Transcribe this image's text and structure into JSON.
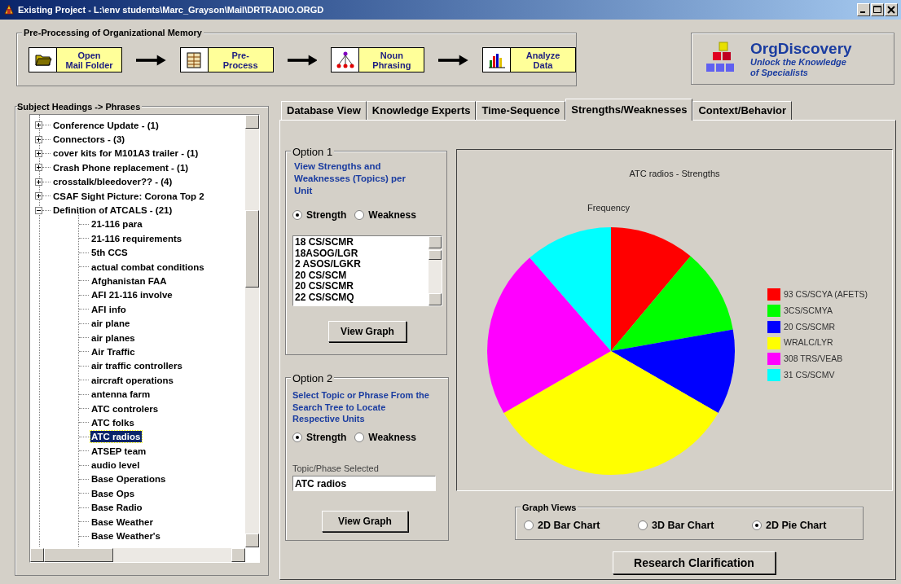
{
  "window": {
    "title": "Existing Project - L:\\env students\\Marc_Grayson\\Mail\\DRTRADIO.ORGD"
  },
  "toolbar": {
    "title": "Pre-Processing of Organizational Memory",
    "steps": [
      {
        "kind": "folder",
        "lines": [
          "Open",
          "Mail Folder"
        ]
      },
      {
        "kind": "table",
        "lines": [
          "Pre-",
          "Process"
        ]
      },
      {
        "kind": "tree",
        "lines": [
          "Noun",
          "Phrasing"
        ]
      },
      {
        "kind": "bars",
        "lines": [
          "Analyze",
          "Data"
        ]
      }
    ]
  },
  "logo": {
    "name": "OrgDiscovery",
    "tagline": [
      "Unlock the Knowledge",
      "of Specialists"
    ]
  },
  "tree": {
    "title": "Subject Headings -> Phrases",
    "items": [
      {
        "label": "Conference Update - (1)",
        "expanded": false,
        "selected": false
      },
      {
        "label": "Connectors - (3)",
        "expanded": false,
        "selected": false
      },
      {
        "label": "cover kits for M101A3 trailer - (1)",
        "expanded": false,
        "selected": false
      },
      {
        "label": "Crash Phone replacement - (1)",
        "expanded": false,
        "selected": false
      },
      {
        "label": "crosstalk/bleedover?? - (4)",
        "expanded": false,
        "selected": false
      },
      {
        "label": "CSAF Sight Picture: Corona Top 2",
        "expanded": false,
        "selected": false
      },
      {
        "label": "Definition of ATCALS - (21)",
        "expanded": true,
        "selected": false,
        "children": [
          {
            "label": "21-116 para",
            "selected": false
          },
          {
            "label": "21-116 requirements",
            "selected": false
          },
          {
            "label": "5th CCS",
            "selected": false
          },
          {
            "label": "actual combat conditions",
            "selected": false
          },
          {
            "label": "Afghanistan FAA",
            "selected": false
          },
          {
            "label": "AFI 21-116 involve",
            "selected": false
          },
          {
            "label": "AFI info",
            "selected": false
          },
          {
            "label": "air plane",
            "selected": false
          },
          {
            "label": "air planes",
            "selected": false
          },
          {
            "label": "Air Traffic",
            "selected": false
          },
          {
            "label": "air traffic controllers",
            "selected": false
          },
          {
            "label": "aircraft operations",
            "selected": false
          },
          {
            "label": "antenna farm",
            "selected": false
          },
          {
            "label": "ATC controlers",
            "selected": false
          },
          {
            "label": "ATC folks",
            "selected": false
          },
          {
            "label": "ATC radios",
            "selected": true
          },
          {
            "label": "ATSEP team",
            "selected": false
          },
          {
            "label": "audio level",
            "selected": false
          },
          {
            "label": "Base Operations",
            "selected": false
          },
          {
            "label": "Base Ops",
            "selected": false
          },
          {
            "label": "Base Radio",
            "selected": false
          },
          {
            "label": "Base Weather",
            "selected": false
          },
          {
            "label": "Base Weather's",
            "selected": false
          }
        ]
      }
    ]
  },
  "tabs": [
    {
      "label": "Database View",
      "selected": false
    },
    {
      "label": "Knowledge Experts",
      "selected": false
    },
    {
      "label": "Time-Sequence",
      "selected": false
    },
    {
      "label": "Strengths/Weaknesses",
      "selected": true
    },
    {
      "label": "Context/Behavior",
      "selected": false
    }
  ],
  "option1": {
    "title": "Option 1",
    "description": "View Strengths and Weaknesses (Topics) per Unit",
    "radios": [
      {
        "label": "Strength",
        "selected": true
      },
      {
        "label": "Weakness",
        "selected": false
      }
    ],
    "units": [
      "18 CS/SCMR",
      "18ASOG/LGR",
      "2 ASOS/LGKR",
      "20 CS/SCM",
      "20 CS/SCMR",
      "22 CS/SCMQ"
    ],
    "button": "View Graph"
  },
  "option2": {
    "title": "Option 2",
    "description": "Select Topic or Phrase From the Search Tree to Locate Respective Units",
    "radios": [
      {
        "label": "Strength",
        "selected": true
      },
      {
        "label": "Weakness",
        "selected": false
      }
    ],
    "field_label": "Topic/Phase Selected",
    "field_value": "ATC radios",
    "button": "View Graph"
  },
  "chart": {
    "title": "ATC radios - Strengths",
    "label": "Frequency",
    "legend": [
      {
        "label": "93 CS/SCYA (AFETS)",
        "color": "#ff0000"
      },
      {
        "label": "3CS/SCMYA",
        "color": "#00ff00"
      },
      {
        "label": "20 CS/SCMR",
        "color": "#0000ff"
      },
      {
        "label": "WRALC/LYR",
        "color": "#ffff00"
      },
      {
        "label": "308 TRS/VEAB",
        "color": "#ff00ff"
      },
      {
        "label": "31 CS/SCMV",
        "color": "#00ffff"
      }
    ]
  },
  "graph_views": {
    "title": "Graph Views",
    "options": [
      {
        "label": "2D Bar Chart",
        "selected": false
      },
      {
        "label": "3D Bar Chart",
        "selected": false
      },
      {
        "label": "2D Pie Chart",
        "selected": true
      }
    ]
  },
  "research_button": "Research Clarification"
}
